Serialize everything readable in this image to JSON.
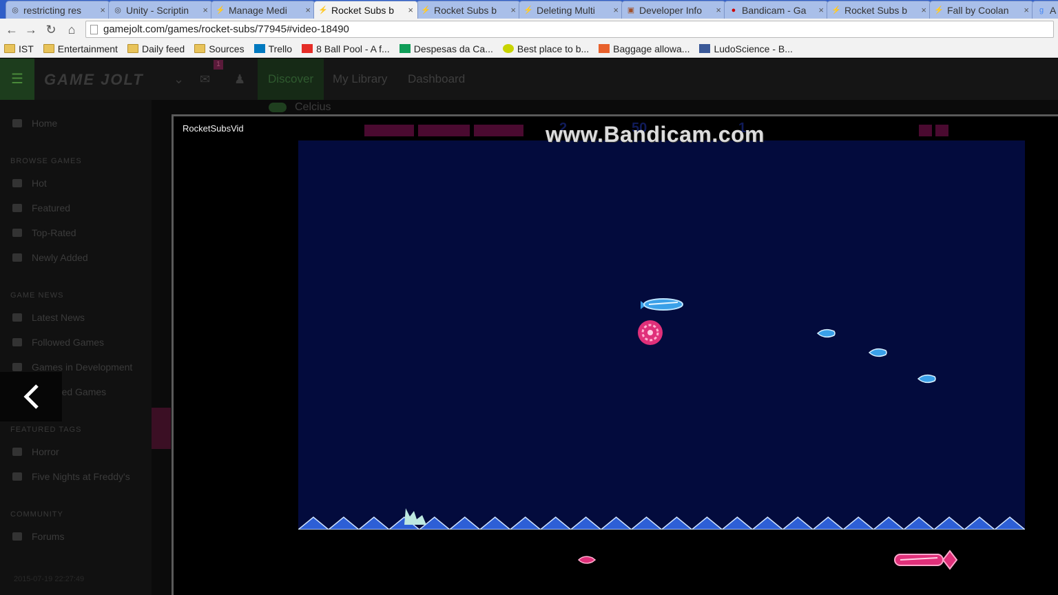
{
  "browser": {
    "tabs": [
      {
        "title": "restricting res",
        "icon": "unity-icon"
      },
      {
        "title": "Unity - Scriptin",
        "icon": "unity-icon"
      },
      {
        "title": "Manage Medi",
        "icon": "gamejolt-icon"
      },
      {
        "title": "Rocket Subs b",
        "icon": "gamejolt-icon",
        "active": true
      },
      {
        "title": "Rocket Subs b",
        "icon": "gamejolt-icon"
      },
      {
        "title": "Deleting Multi",
        "icon": "gamejolt-icon"
      },
      {
        "title": "Developer Info",
        "icon": "instagram-icon"
      },
      {
        "title": "Bandicam - Ga",
        "icon": "bandicam-icon"
      },
      {
        "title": "Rocket Subs b",
        "icon": "gamejolt-icon"
      },
      {
        "title": "Fall by Coolan",
        "icon": "gamejolt-icon"
      },
      {
        "title": "A",
        "icon": "google-icon"
      }
    ],
    "url": "gamejolt.com/games/rocket-subs/77945#video-18490",
    "bookmarks": [
      {
        "label": "IST",
        "icon": "folder"
      },
      {
        "label": "Entertainment",
        "icon": "folder"
      },
      {
        "label": "Daily feed",
        "icon": "folder"
      },
      {
        "label": "Sources",
        "icon": "folder"
      },
      {
        "label": "Trello",
        "icon": "trello"
      },
      {
        "label": "8 Ball Pool - A f...",
        "icon": "youtube"
      },
      {
        "label": "Despesas da Ca...",
        "icon": "sheets"
      },
      {
        "label": "Best place to b...",
        "icon": "smiley"
      },
      {
        "label": "Baggage allowa...",
        "icon": "e"
      },
      {
        "label": "LudoScience - B...",
        "icon": "facebook"
      }
    ]
  },
  "site": {
    "logo": "GAME JOLT",
    "notification_count": "1",
    "nav": {
      "discover": "Discover",
      "library": "My Library",
      "dashboard": "Dashboard"
    },
    "celcius": "Celcius",
    "sidebar": {
      "home": "Home",
      "browse_heading": "BROWSE GAMES",
      "browse": [
        "Hot",
        "Featured",
        "Top-Rated",
        "Newly Added"
      ],
      "news_heading": "GAME NEWS",
      "news": [
        "Latest News",
        "Followed Games",
        "Games in Development",
        "Released Games"
      ],
      "tags_heading": "FEATURED TAGS",
      "tags": [
        "Horror",
        "Five Nights at Freddy's"
      ],
      "community_heading": "COMMUNITY",
      "community": [
        "Forums"
      ],
      "timestamp": "2015-07-19 22:27:49"
    }
  },
  "player": {
    "title": "RocketSubsVid",
    "watermark": "www.Bandicam.com",
    "hud_numbers": [
      "2",
      "50",
      "1"
    ],
    "colors": {
      "water": "#030b3d",
      "hud": "#4a0a30",
      "player_sub": "#e0307a",
      "enemy": "#3aa0e8"
    }
  }
}
